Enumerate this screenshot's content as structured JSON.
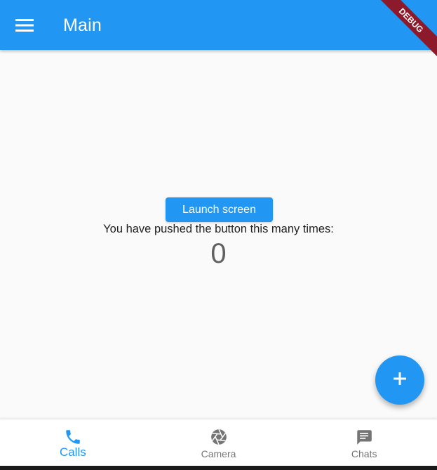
{
  "appbar": {
    "title": "Main",
    "menu_icon": "menu-icon",
    "color": "#2196f3"
  },
  "debug_banner": {
    "label": "DEBUG",
    "color": "#8c1a2a"
  },
  "main": {
    "launch_button_label": "Launch screen",
    "pushed_text": "You have pushed the button this many times:",
    "counter": "0"
  },
  "fab": {
    "icon": "add-icon"
  },
  "bottom_nav": {
    "items": [
      {
        "label": "Calls",
        "icon": "phone-icon",
        "active": true
      },
      {
        "label": "Camera",
        "icon": "camera-aperture-icon",
        "active": false
      },
      {
        "label": "Chats",
        "icon": "chat-icon",
        "active": false
      }
    ],
    "active_color": "#2196f3",
    "inactive_color": "#757575"
  }
}
